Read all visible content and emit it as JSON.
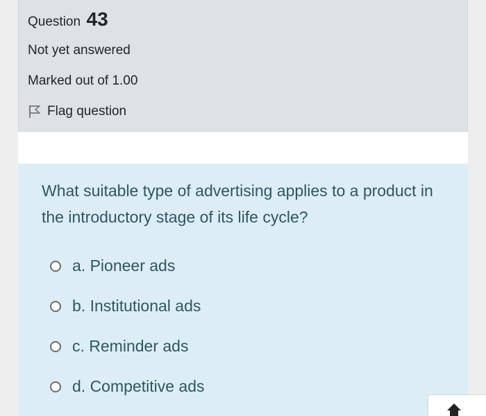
{
  "question_info": {
    "label": "Question",
    "number": "43",
    "state": "Not yet answered",
    "grade": "Marked out of 1.00",
    "flag_label": "Flag question"
  },
  "question": {
    "text": "What suitable type of advertising applies to a product in the introductory stage of its life cycle?",
    "options": [
      "a. Pioneer ads",
      "b. Institutional ads",
      "c. Reminder ads",
      "d. Competitive ads"
    ]
  },
  "icons": {
    "flag": "flag-icon",
    "radio": "radio-icon",
    "scroll_top": "arrow-up-icon"
  },
  "colors": {
    "info_background": "#dee2e6",
    "content_background": "#dcedf5",
    "question_text": "#2f5660"
  }
}
